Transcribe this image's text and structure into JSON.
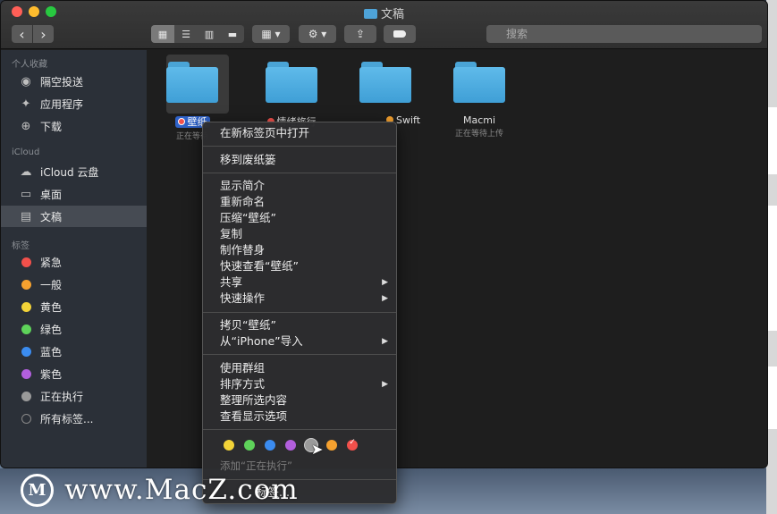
{
  "window": {
    "title": "文稿"
  },
  "toolbar": {
    "back": "‹",
    "forward": "›",
    "search_placeholder": "搜索"
  },
  "sidebar": {
    "sections": [
      {
        "title": "个人收藏",
        "items": [
          {
            "label": "隔空投送",
            "icon": "airdrop-icon"
          },
          {
            "label": "应用程序",
            "icon": "applications-icon"
          },
          {
            "label": "下载",
            "icon": "download-icon"
          }
        ]
      },
      {
        "title": "iCloud",
        "items": [
          {
            "label": "iCloud 云盘",
            "icon": "cloud-icon"
          },
          {
            "label": "桌面",
            "icon": "desktop-icon"
          },
          {
            "label": "文稿",
            "icon": "document-icon",
            "selected": true
          }
        ]
      },
      {
        "title": "标签",
        "items": [
          {
            "label": "紧急",
            "color": "#f2504b"
          },
          {
            "label": "一般",
            "color": "#f5a12f"
          },
          {
            "label": "黄色",
            "color": "#f3d338"
          },
          {
            "label": "绿色",
            "color": "#5ed35a"
          },
          {
            "label": "蓝色",
            "color": "#3b8cf0"
          },
          {
            "label": "紫色",
            "color": "#b25fdd"
          },
          {
            "label": "正在执行",
            "color": "#9a9a9a"
          },
          {
            "label": "所有标签...",
            "color": "hollow"
          }
        ]
      }
    ]
  },
  "files": [
    {
      "name": "壁纸",
      "status": "正在等待",
      "tag_color": "#f2504b",
      "selected": true
    },
    {
      "name": "情绪旅行",
      "status": "",
      "tag_color": "#f2504b"
    },
    {
      "name": "Swift",
      "status": "",
      "tag_color": "#f5a12f"
    },
    {
      "name": "Macmi",
      "status": "正在等待上传",
      "tag_color": ""
    }
  ],
  "context_menu": {
    "items": [
      {
        "label": "在新标签页中打开"
      },
      {
        "sep": true
      },
      {
        "label": "移到废纸篓"
      },
      {
        "sep": true
      },
      {
        "label": "显示简介"
      },
      {
        "label": "重新命名"
      },
      {
        "label": "压缩“壁纸”"
      },
      {
        "label": "复制"
      },
      {
        "label": "制作替身"
      },
      {
        "label": "快速查看“壁纸”"
      },
      {
        "label": "共享",
        "submenu": true
      },
      {
        "label": "快速操作",
        "submenu": true
      },
      {
        "sep": true
      },
      {
        "label": "拷贝“壁纸”"
      },
      {
        "label": "从“iPhone”导入",
        "submenu": true
      },
      {
        "sep": true
      },
      {
        "label": "使用群组"
      },
      {
        "label": "排序方式",
        "submenu": true
      },
      {
        "label": "整理所选内容"
      },
      {
        "label": "查看显示选项"
      },
      {
        "sep": true
      }
    ],
    "tag_colors": [
      "#f3d338",
      "#5ed35a",
      "#3b8cf0",
      "#b25fdd",
      "#9a9a9a",
      "#f5a12f",
      "#f2504b"
    ],
    "add_tag_label": "添加“正在执行”",
    "tags_label": "标签..."
  },
  "watermark": {
    "logo": "M",
    "text": "www.MacZ.com"
  }
}
